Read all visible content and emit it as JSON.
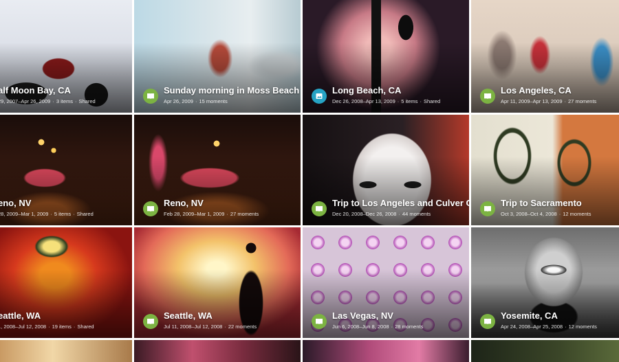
{
  "colors": {
    "badge_green": "#7cb342",
    "badge_teal": "#26a3c4",
    "page_bg": "#ffffff"
  },
  "albums": [
    {
      "title": "alf Moon Bay, CA",
      "dates": "29, 2007–Apr 26, 2009",
      "count": "3 items",
      "shared": "Shared",
      "badge": "none",
      "icon": "album-icon"
    },
    {
      "title": "Sunday morning in Moss Beach",
      "dates": "Apr 26, 2009",
      "count": "15 moments",
      "shared": "",
      "badge": "green",
      "icon": "story-book-icon"
    },
    {
      "title": "Long Beach, CA",
      "dates": "Dec 26, 2008–Apr 13, 2009",
      "count": "5 items",
      "shared": "Shared",
      "badge": "teal",
      "icon": "album-icon"
    },
    {
      "title": "Los Angeles, CA",
      "dates": "Apr 11, 2009–Apr 13, 2009",
      "count": "27 moments",
      "shared": "",
      "badge": "green",
      "icon": "story-book-icon"
    },
    {
      "title": "eno, NV",
      "dates": "28, 2009–Mar 1, 2009",
      "count": "5 items",
      "shared": "Shared",
      "badge": "none",
      "icon": "album-icon"
    },
    {
      "title": "Reno, NV",
      "dates": "Feb 28, 2009–Mar 1, 2009",
      "count": "27 moments",
      "shared": "",
      "badge": "green",
      "icon": "story-book-icon"
    },
    {
      "title": "Trip to Los Angeles and Culver City",
      "dates": "Dec 20, 2008–Dec 26, 2008",
      "count": "44 moments",
      "shared": "",
      "badge": "green",
      "icon": "story-book-icon"
    },
    {
      "title": "Trip to Sacramento",
      "dates": "Oct 3, 2008–Oct 4, 2008",
      "count": "12 moments",
      "shared": "",
      "badge": "green",
      "icon": "story-book-icon"
    },
    {
      "title": "eattle, WA",
      "dates": "1, 2008–Jul 12, 2008",
      "count": "19 items",
      "shared": "Shared",
      "badge": "none",
      "icon": "album-icon"
    },
    {
      "title": "Seattle, WA",
      "dates": "Jul 11, 2008–Jul 12, 2008",
      "count": "22 moments",
      "shared": "",
      "badge": "green",
      "icon": "story-book-icon"
    },
    {
      "title": "Las Vegas, NV",
      "dates": "Jun 6, 2008–Jun 8, 2008",
      "count": "28 moments",
      "shared": "",
      "badge": "green",
      "icon": "story-book-icon"
    },
    {
      "title": "Yosemite, CA",
      "dates": "Apr 24, 2008–Apr 25, 2008",
      "count": "12 moments",
      "shared": "",
      "badge": "green",
      "icon": "story-book-icon"
    }
  ]
}
